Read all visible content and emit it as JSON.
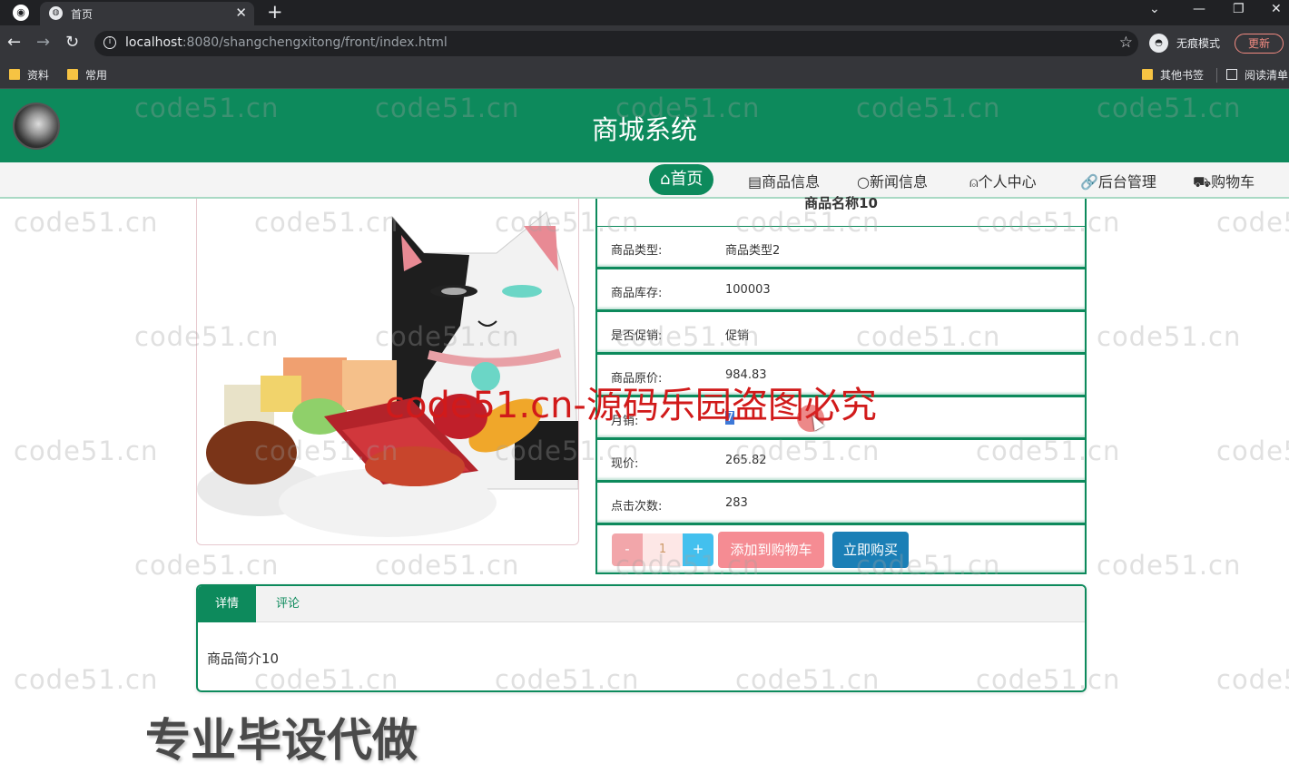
{
  "browser": {
    "tab_title": "首页",
    "url_host": "localhost",
    "url_rest": ":8080/shangchengxitong/front/index.html",
    "incognito_label": "无痕模式",
    "update_label": "更新",
    "bookmarks": [
      "资料",
      "常用"
    ],
    "other_bookmarks": "其他书签",
    "reading_list": "阅读清单"
  },
  "site": {
    "title": "商城系统",
    "nav": [
      {
        "label": "首页",
        "icon": "home-icon"
      },
      {
        "label": "商品信息",
        "icon": "product-icon"
      },
      {
        "label": "新闻信息",
        "icon": "news-icon"
      },
      {
        "label": "个人中心",
        "icon": "user-icon"
      },
      {
        "label": "后台管理",
        "icon": "link-icon"
      },
      {
        "label": "购物车",
        "icon": "cart-icon"
      }
    ]
  },
  "product": {
    "name": "商品名称10",
    "fields": [
      {
        "label": "商品类型:",
        "value": "商品类型2"
      },
      {
        "label": "商品库存:",
        "value": "100003"
      },
      {
        "label": "是否促销:",
        "value": "促销"
      },
      {
        "label": "商品原价:",
        "value": "984.83"
      },
      {
        "label": "月销:",
        "value": "7"
      },
      {
        "label": "现价:",
        "value": "265.82"
      },
      {
        "label": "点击次数:",
        "value": "283"
      }
    ],
    "quantity": "1",
    "minus_label": "-",
    "plus_label": "+",
    "add_to_cart_label": "添加到购物车",
    "buy_now_label": "立即购买"
  },
  "tabs": {
    "detail_label": "详情",
    "comment_label": "评论",
    "content": "商品简介10"
  },
  "overlays": {
    "watermark": "code51.cn",
    "red_watermark": "code51.cn-源码乐园盗图必究",
    "promo": "专业毕设代做"
  },
  "colors": {
    "primary": "#0d8a5c",
    "add_cart": "#f58c93",
    "buy_now": "#1b7fb6",
    "watermark_red": "#d11a1a"
  }
}
